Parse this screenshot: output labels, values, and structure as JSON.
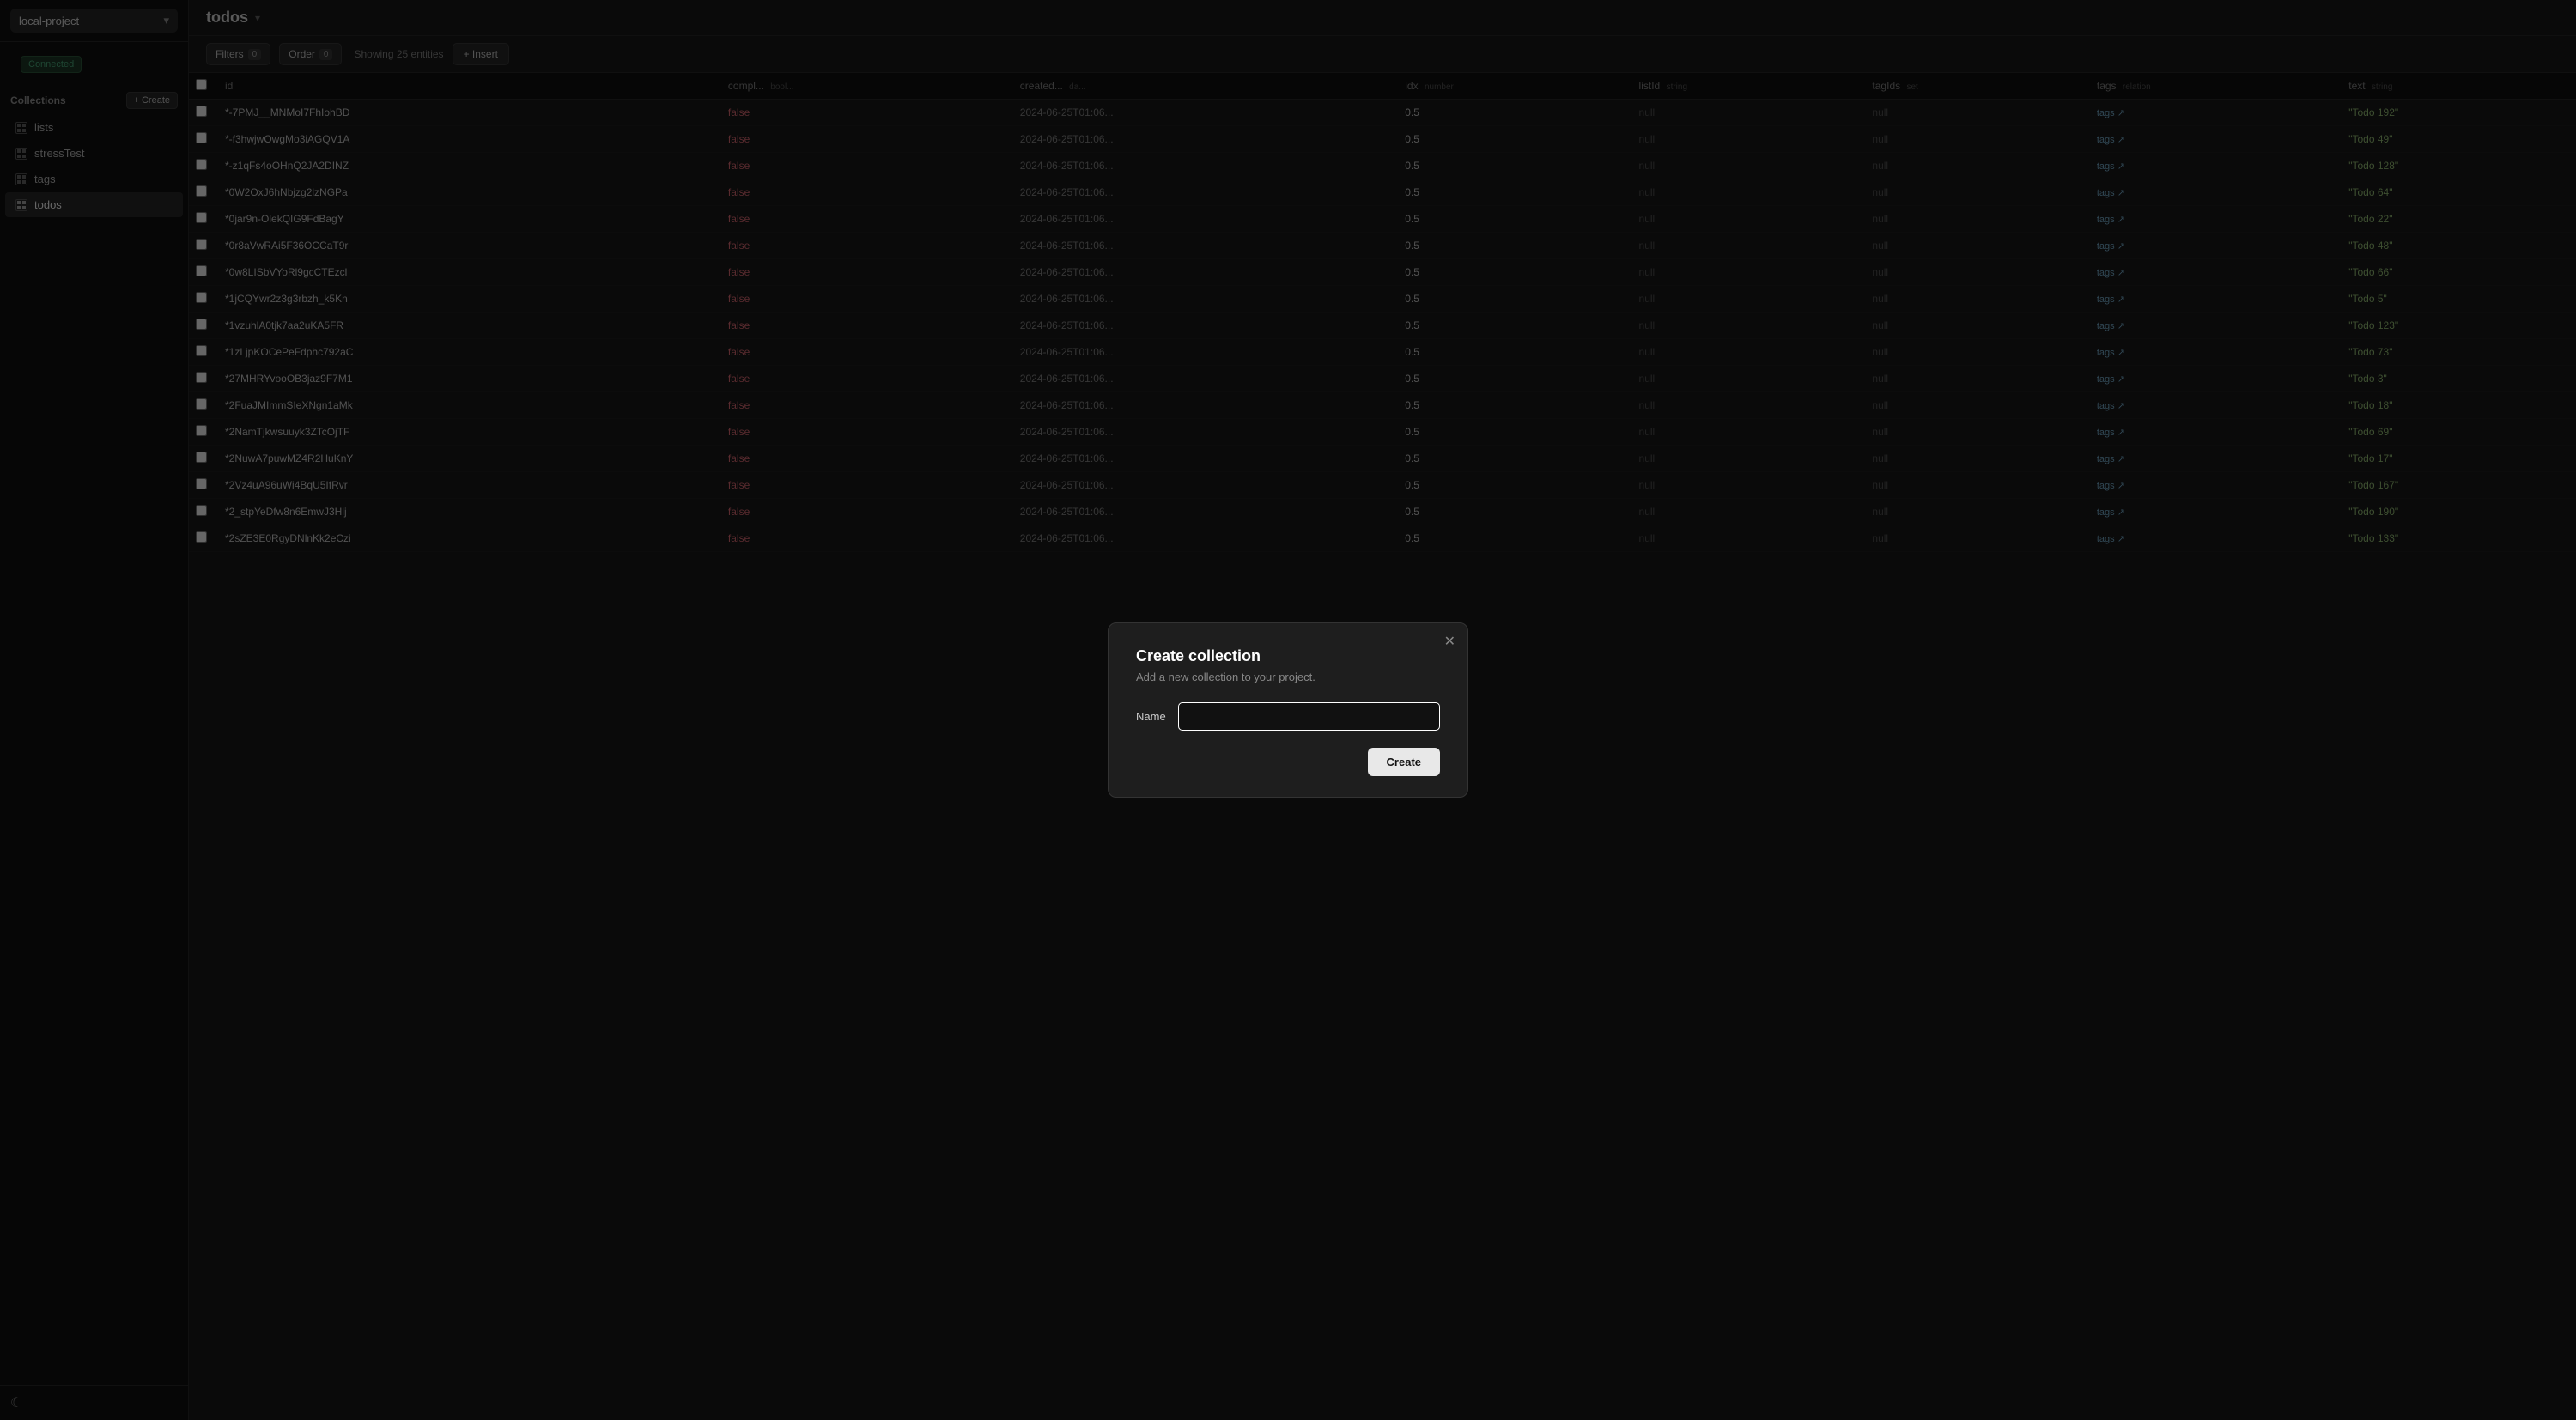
{
  "sidebar": {
    "project": {
      "name": "local-project",
      "chevron": "▾"
    },
    "connected_label": "Connected",
    "collections_title": "Collections",
    "create_label": "+ Create",
    "items": [
      {
        "id": "lists",
        "label": "lists"
      },
      {
        "id": "stressTest",
        "label": "stressTest"
      },
      {
        "id": "tags",
        "label": "tags"
      },
      {
        "id": "todos",
        "label": "todos",
        "active": true
      }
    ],
    "theme_icon": "☾"
  },
  "main": {
    "title": "todos",
    "title_icon": "▾",
    "toolbar": {
      "filters_label": "Filters",
      "filters_count": "0",
      "order_label": "Order",
      "order_count": "0",
      "showing_text": "Showing 25 entities",
      "insert_label": "+ Insert"
    },
    "table": {
      "columns": [
        {
          "id": "id",
          "label": "id",
          "type": ""
        },
        {
          "id": "completed",
          "label": "compl...",
          "type": "bool..."
        },
        {
          "id": "created_at",
          "label": "created...",
          "type": "da..."
        },
        {
          "id": "idx",
          "label": "idx",
          "type": "number"
        },
        {
          "id": "listId",
          "label": "listId",
          "type": "string"
        },
        {
          "id": "tagIds",
          "label": "tagIds",
          "type": "set"
        },
        {
          "id": "tags",
          "label": "tags",
          "type": "relation"
        },
        {
          "id": "text",
          "label": "text",
          "type": "string"
        }
      ],
      "rows": [
        {
          "id": "*-7PMJ__MNMoI7FhIohBD",
          "completed": "false",
          "created_at": "2024-06-25T01:06...",
          "idx": "0.5",
          "listId": "null",
          "tagIds": "null",
          "tags": "tags",
          "text": "\"Todo 192\""
        },
        {
          "id": "*-f3hwjwOwgMo3iAGQV1A",
          "completed": "false",
          "created_at": "2024-06-25T01:06...",
          "idx": "0.5",
          "listId": "null",
          "tagIds": "null",
          "tags": "tags",
          "text": "\"Todo 49\""
        },
        {
          "id": "*-z1qFs4oOHnQ2JA2DINZ",
          "completed": "false",
          "created_at": "2024-06-25T01:06...",
          "idx": "0.5",
          "listId": "null",
          "tagIds": "null",
          "tags": "tags",
          "text": "\"Todo 128\""
        },
        {
          "id": "*0W2OxJ6hNbjzg2lzNGPa",
          "completed": "false",
          "created_at": "2024-06-25T01:06...",
          "idx": "0.5",
          "listId": "null",
          "tagIds": "null",
          "tags": "tags",
          "text": "\"Todo 64\""
        },
        {
          "id": "*0jar9n-OlekQIG9FdBagY",
          "completed": "false",
          "created_at": "2024-06-25T01:06...",
          "idx": "0.5",
          "listId": "null",
          "tagIds": "null",
          "tags": "tags",
          "text": "\"Todo 22\""
        },
        {
          "id": "*0r8aVwRAi5F36OCCaT9r",
          "completed": "false",
          "created_at": "2024-06-25T01:06...",
          "idx": "0.5",
          "listId": "null",
          "tagIds": "null",
          "tags": "tags",
          "text": "\"Todo 48\""
        },
        {
          "id": "*0w8LISbVYoRl9gcCTEzcl",
          "completed": "false",
          "created_at": "2024-06-25T01:06...",
          "idx": "0.5",
          "listId": "null",
          "tagIds": "null",
          "tags": "tags",
          "text": "\"Todo 66\""
        },
        {
          "id": "*1jCQYwr2z3g3rbzh_k5Kn",
          "completed": "false",
          "created_at": "2024-06-25T01:06...",
          "idx": "0.5",
          "listId": "null",
          "tagIds": "null",
          "tags": "tags",
          "text": "\"Todo 5\""
        },
        {
          "id": "*1vzuhlA0tjk7aa2uKA5FR",
          "completed": "false",
          "created_at": "2024-06-25T01:06...",
          "idx": "0.5",
          "listId": "null",
          "tagIds": "null",
          "tags": "tags",
          "text": "\"Todo 123\""
        },
        {
          "id": "*1zLjpKOCePeFdphc792aC",
          "completed": "false",
          "created_at": "2024-06-25T01:06...",
          "idx": "0.5",
          "listId": "null",
          "tagIds": "null",
          "tags": "tags",
          "text": "\"Todo 73\""
        },
        {
          "id": "*27MHRYvooOB3jaz9F7M1",
          "completed": "false",
          "created_at": "2024-06-25T01:06...",
          "idx": "0.5",
          "listId": "null",
          "tagIds": "null",
          "tags": "tags",
          "text": "\"Todo 3\""
        },
        {
          "id": "*2FuaJMImmSIeXNgn1aMk",
          "completed": "false",
          "created_at": "2024-06-25T01:06...",
          "idx": "0.5",
          "listId": "null",
          "tagIds": "null",
          "tags": "tags",
          "text": "\"Todo 18\""
        },
        {
          "id": "*2NamTjkwsuuyk3ZTcOjTF",
          "completed": "false",
          "created_at": "2024-06-25T01:06...",
          "idx": "0.5",
          "listId": "null",
          "tagIds": "null",
          "tags": "tags",
          "text": "\"Todo 69\""
        },
        {
          "id": "*2NuwA7puwMZ4R2HuKnY",
          "completed": "false",
          "created_at": "2024-06-25T01:06...",
          "idx": "0.5",
          "listId": "null",
          "tagIds": "null",
          "tags": "tags",
          "text": "\"Todo 17\""
        },
        {
          "id": "*2Vz4uA96uWi4BqU5IfRvr",
          "completed": "false",
          "created_at": "2024-06-25T01:06...",
          "idx": "0.5",
          "listId": "null",
          "tagIds": "null",
          "tags": "tags",
          "text": "\"Todo 167\""
        },
        {
          "id": "*2_stpYeDfw8n6EmwJ3Hlj",
          "completed": "false",
          "created_at": "2024-06-25T01:06...",
          "idx": "0.5",
          "listId": "null",
          "tagIds": "null",
          "tags": "tags",
          "text": "\"Todo 190\""
        },
        {
          "id": "*2sZE3E0RgyDNlnKk2eCzi",
          "completed": "false",
          "created_at": "2024-06-25T01:06...",
          "idx": "0.5",
          "listId": "null",
          "tagIds": "null",
          "tags": "tags",
          "text": "\"Todo 133\""
        }
      ]
    }
  },
  "modal": {
    "title": "Create collection",
    "subtitle": "Add a new collection to your project.",
    "name_label": "Name",
    "name_placeholder": "",
    "create_label": "Create",
    "close_icon": "✕"
  }
}
